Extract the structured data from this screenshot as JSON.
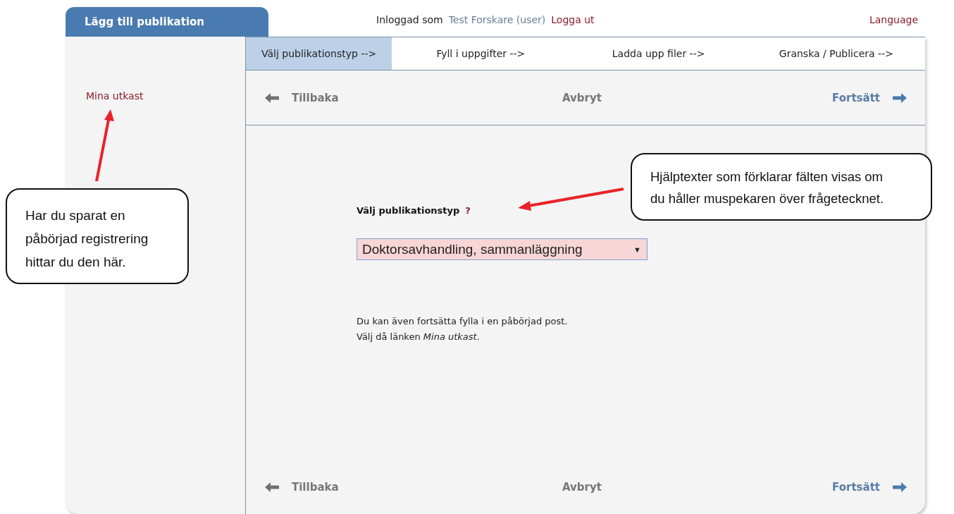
{
  "header": {
    "title": "Lägg till publikation",
    "logged_in_label": "Inloggad som",
    "user": "Test Forskare (user)",
    "logout": "Logga ut",
    "language": "Language"
  },
  "sidebar": {
    "items": [
      {
        "label": "Mina utkast"
      }
    ]
  },
  "steps": [
    {
      "label": "Välj publikationstyp -->",
      "selected": true
    },
    {
      "label": "Fyll i uppgifter -->",
      "selected": false
    },
    {
      "label": "Ladda upp filer -->",
      "selected": false
    },
    {
      "label": "Granska / Publicera -->",
      "selected": false
    }
  ],
  "nav_top": {
    "back": "Tillbaka",
    "cancel": "Avbryt",
    "next": "Fortsätt"
  },
  "form": {
    "label": "Välj publikationstyp",
    "help": "?",
    "select_value": "Doktorsavhandling, sammanläggning",
    "select_caret": "▼",
    "note": [
      "Du kan även fortsätta fylla i en påbörjad post.",
      "Välj då länken *Mina utkast*."
    ]
  },
  "nav_bottom": {
    "back": "Tillbaka",
    "cancel": "Avbryt",
    "next": "Fortsätt"
  },
  "callouts": [
    {
      "lines": [
        "Har du sparat en",
        "påbörjad registrering",
        "hittar du den här."
      ]
    },
    {
      "lines": [
        "Hjälptexter som förklarar fälten visas om",
        "du håller muspekaren över frågetecknet."
      ]
    }
  ]
}
